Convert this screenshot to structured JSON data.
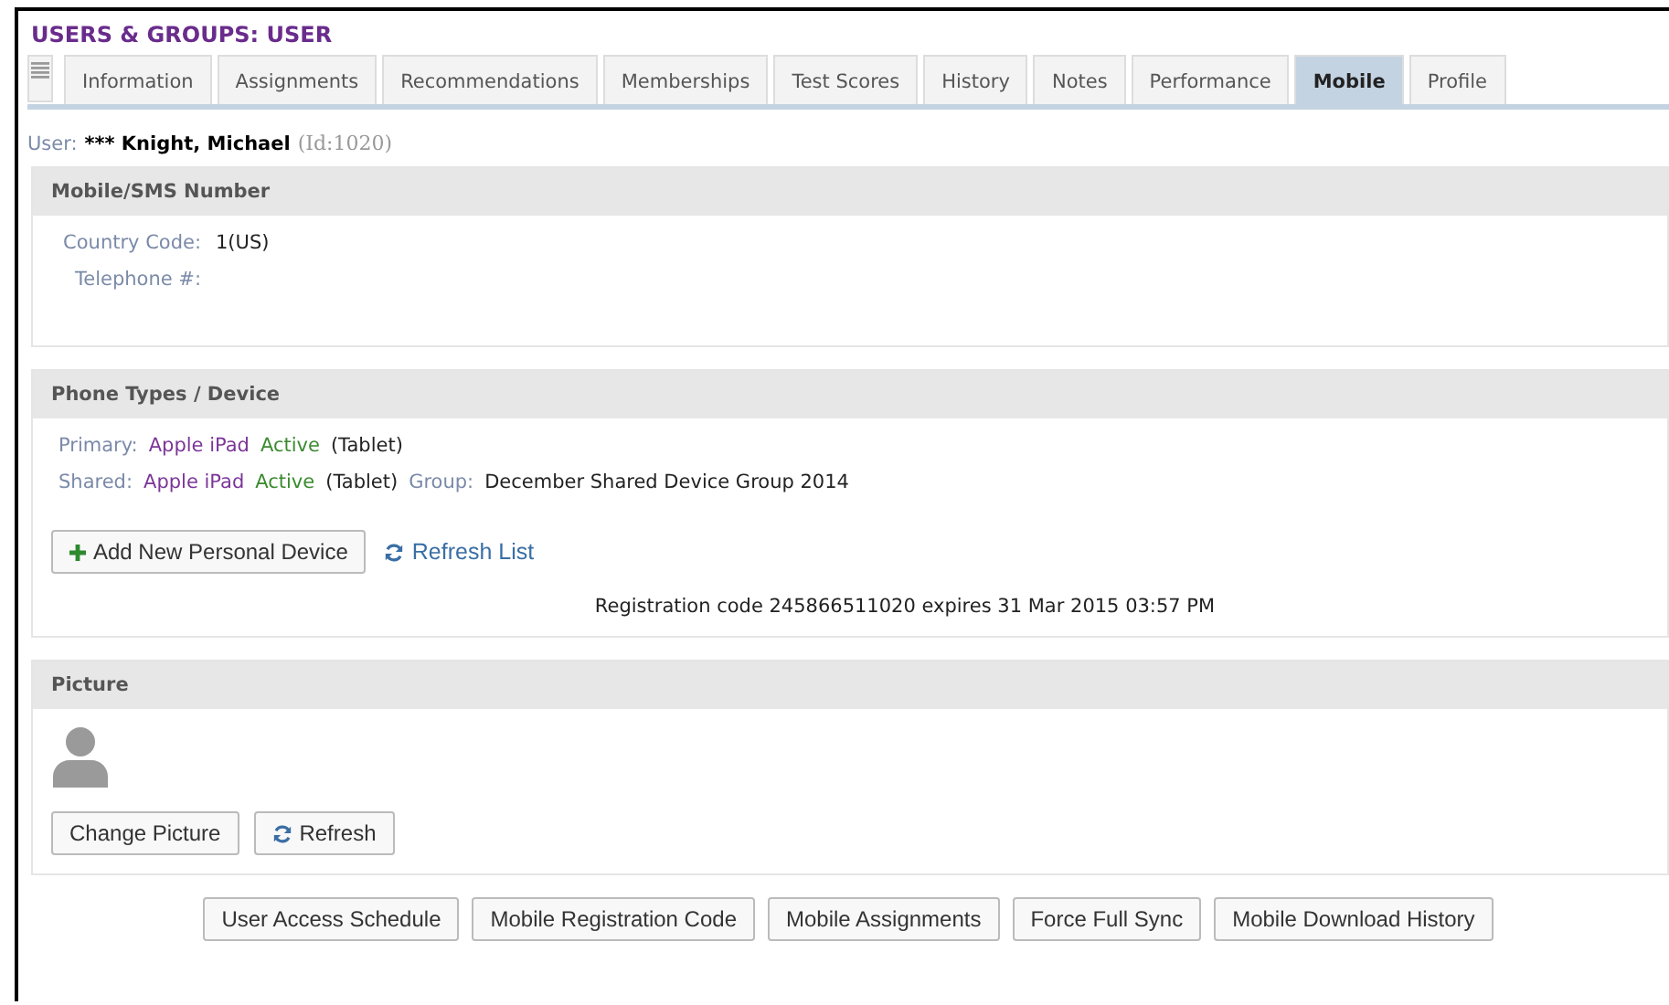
{
  "page_title": "USERS & GROUPS: USER",
  "tabs": [
    {
      "label": "Information",
      "selected": false
    },
    {
      "label": "Assignments",
      "selected": false
    },
    {
      "label": "Recommendations",
      "selected": false
    },
    {
      "label": "Memberships",
      "selected": false
    },
    {
      "label": "Test Scores",
      "selected": false
    },
    {
      "label": "History",
      "selected": false
    },
    {
      "label": "Notes",
      "selected": false
    },
    {
      "label": "Performance",
      "selected": false
    },
    {
      "label": "Mobile",
      "selected": true
    },
    {
      "label": "Profile",
      "selected": false
    }
  ],
  "user": {
    "label": "User:",
    "name": "*** Knight, Michael",
    "id": "(Id:1020)"
  },
  "mobile_section": {
    "title": "Mobile/SMS Number",
    "fields": [
      {
        "label": "Country Code:",
        "value": "1(US)"
      },
      {
        "label": "Telephone #:"
      }
    ]
  },
  "device_section": {
    "title": "Phone Types / Device",
    "devices": [
      {
        "label": "Primary:",
        "device": "Apple iPad",
        "status": "Active",
        "type": "(Tablet)"
      },
      {
        "label": "Shared:",
        "device": "Apple iPad",
        "status": "Active",
        "type": "(Tablet)",
        "group_label": "Group:",
        "group": "December Shared Device Group 2014"
      }
    ],
    "add_button": "Add New Personal Device",
    "refresh_link": "Refresh List",
    "registration": "Registration code 245866511020 expires 31 Mar 2015 03:57 PM"
  },
  "picture_section": {
    "title": "Picture",
    "change_button": "Change Picture",
    "refresh_button": "Refresh"
  },
  "footer_buttons": [
    "User Access Schedule",
    "Mobile Registration Code",
    "Mobile Assignments",
    "Force Full Sync",
    "Mobile Download History"
  ]
}
